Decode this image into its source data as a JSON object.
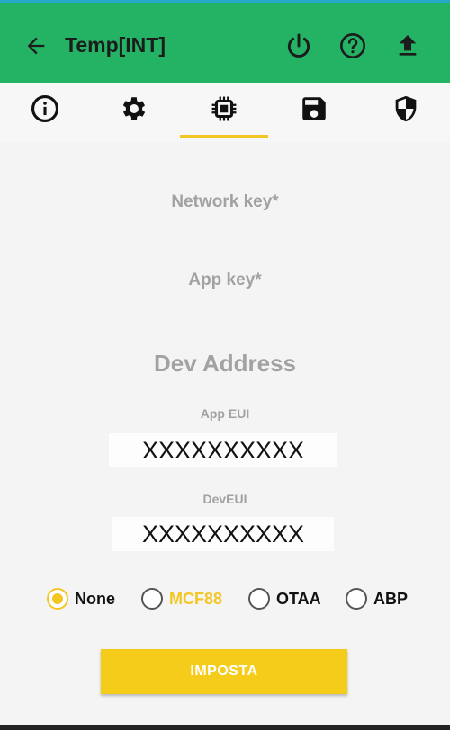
{
  "header": {
    "title": "Temp[INT]",
    "background": "#24b265",
    "icons": [
      "arrow-back-icon",
      "power-icon",
      "help-icon",
      "upload-icon"
    ]
  },
  "tabs": {
    "items": [
      "info-icon",
      "gear-icon",
      "chip-icon",
      "save-icon",
      "shield-icon"
    ],
    "selected_index": 2,
    "indicator_color": "#f3c623"
  },
  "form": {
    "network_key_label": "Network key*",
    "app_key_label": "App key*",
    "dev_address_label": "Dev Address",
    "app_eui_label": "App EUI",
    "app_eui_value": "XXXXXXXXXX",
    "dev_eui_label": "DevEUI",
    "dev_eui_value": "XXXXXXXXXX"
  },
  "mode": {
    "options": [
      "None",
      "MCF88",
      "OTAA",
      "ABP"
    ],
    "selected": "None",
    "highlight_option": "MCF88",
    "highlight_color": "#f3c623"
  },
  "submit_label": "IMPOSTA"
}
